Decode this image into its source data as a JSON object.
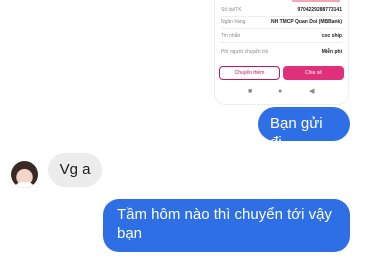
{
  "receipt": {
    "rows": [
      {
        "key": "Số tài/TK",
        "value": "9704229288773141"
      },
      {
        "key": "Ngân hàng",
        "value": "NH TMCP Quan Doi (MBBank)"
      },
      {
        "key": "Tin nhắn",
        "value": "coc ship"
      },
      {
        "key": "Phí người chuyển trả",
        "value": "Miễn phí"
      }
    ],
    "transfer_more_label": "Chuyển thêm",
    "share_label": "Chia sẻ",
    "nav_icons": [
      "■",
      "●",
      "◀"
    ],
    "accent_color": "#e0307a"
  },
  "messages": [
    {
      "direction": "outgoing",
      "text": "Bạn gửi đi"
    },
    {
      "direction": "incoming",
      "text": "Vg a"
    },
    {
      "direction": "outgoing",
      "text": "Tầm hôm nào thì chuyển tới vậy bạn"
    }
  ],
  "colors": {
    "outgoing_bubble": "#2f6fe6",
    "incoming_bubble": "#ececec"
  }
}
